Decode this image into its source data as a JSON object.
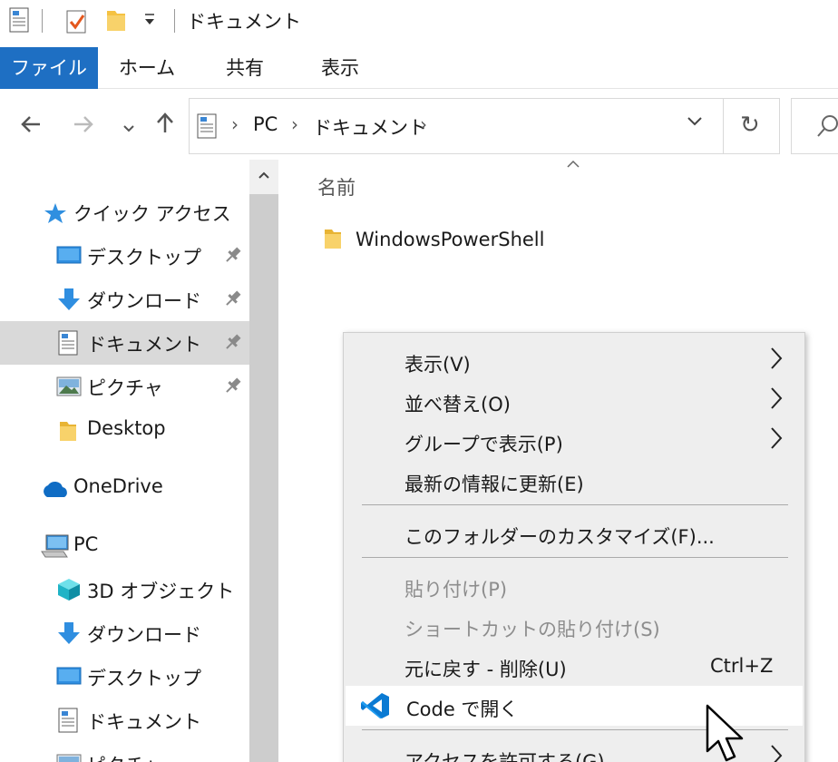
{
  "window": {
    "title": "ドキュメント"
  },
  "ribbon": {
    "tabs": [
      "ファイル",
      "ホーム",
      "共有",
      "表示"
    ]
  },
  "address": {
    "crumbs": [
      "PC",
      "ドキュメント"
    ]
  },
  "nav": {
    "quick_access": "クイック アクセス",
    "items": [
      {
        "label": "デスクトップ",
        "icon": "desktop-icon",
        "pinned": true
      },
      {
        "label": "ダウンロード",
        "icon": "download-icon",
        "pinned": true
      },
      {
        "label": "ドキュメント",
        "icon": "document-icon",
        "pinned": true,
        "selected": true
      },
      {
        "label": "ピクチャ",
        "icon": "pictures-icon",
        "pinned": true
      },
      {
        "label": "Desktop",
        "icon": "folder-icon"
      }
    ],
    "onedrive": "OneDrive",
    "pc": "PC",
    "pc_items": [
      {
        "label": "3D オブジェクト",
        "icon": "3d-objects-icon"
      },
      {
        "label": "ダウンロード",
        "icon": "download-icon"
      },
      {
        "label": "デスクトップ",
        "icon": "desktop-icon"
      },
      {
        "label": "ドキュメント",
        "icon": "document-icon"
      },
      {
        "label": "ピクチャ",
        "icon": "pictures-icon"
      }
    ]
  },
  "content": {
    "column_header": "名前",
    "files": [
      {
        "name": "WindowsPowerShell",
        "icon": "folder-icon"
      }
    ]
  },
  "context_menu": {
    "items": [
      {
        "label": "表示(V)",
        "submenu": true
      },
      {
        "label": "並べ替え(O)",
        "submenu": true
      },
      {
        "label": "グループで表示(P)",
        "submenu": true
      },
      {
        "label": "最新の情報に更新(E)"
      },
      {
        "label": "このフォルダーのカスタマイズ(F)..."
      },
      {
        "label": "貼り付け(P)",
        "disabled": true
      },
      {
        "label": "ショートカットの貼り付け(S)",
        "disabled": true
      },
      {
        "label": "元に戻す - 削除(U)",
        "shortcut": "Ctrl+Z"
      },
      {
        "label": "Code で開く",
        "icon": "vscode-icon",
        "hovered": true
      },
      {
        "label": "アクセスを許可する(G)",
        "submenu": true
      }
    ]
  },
  "colors": {
    "accent": "#1e6fc3",
    "selection": "#d9d9d9",
    "menu_bg": "#eeeeee",
    "vscode_blue": "#0a7ad3"
  }
}
